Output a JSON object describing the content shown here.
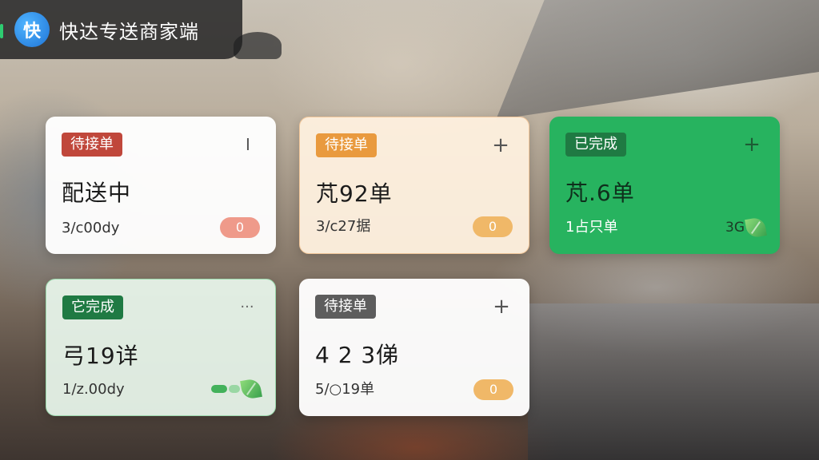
{
  "app": {
    "title": "快达专送商家端",
    "logo_text": "快"
  },
  "cards": [
    {
      "badge": "待接单",
      "icon": "menu-bar-icon",
      "icon_glyph": "I",
      "main": "配送中",
      "sub": "3/c00dy",
      "pill": "0"
    },
    {
      "badge": "待接单",
      "icon": "plus-icon",
      "icon_glyph": "+",
      "main": "芃92单",
      "sub": "3/c27据",
      "pill": "0"
    },
    {
      "badge": "已完成",
      "icon": "plus-icon",
      "icon_glyph": "+",
      "main": "芃.6单",
      "sub": "1占只单",
      "pill": "3G"
    },
    {
      "badge": "它完成",
      "icon": "more-icon",
      "icon_glyph": "···",
      "main": "弓19详",
      "sub": "1/z.00dy",
      "pill": ""
    },
    {
      "badge": "待接单",
      "icon": "plus-icon",
      "icon_glyph": "+",
      "main": "4 2 3俤",
      "sub": "5/○19单",
      "pill": "0"
    }
  ],
  "colors": {
    "badge_red": "#c0473b",
    "badge_orange": "#e99a3e",
    "badge_darkgreen": "#1f7a43",
    "badge_gray": "#5d5d5d",
    "card_green": "#27b35f"
  }
}
